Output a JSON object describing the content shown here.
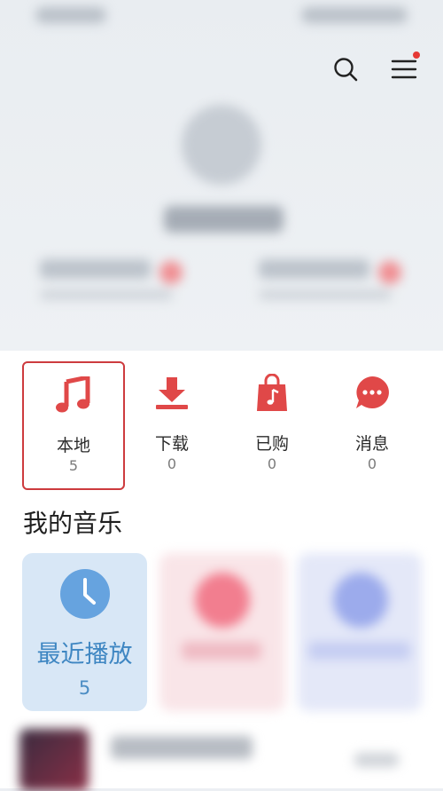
{
  "quick_access": [
    {
      "label": "本地",
      "count": "5",
      "icon": "music-note-icon",
      "selected": true
    },
    {
      "label": "下载",
      "count": "0",
      "icon": "download-icon",
      "selected": false
    },
    {
      "label": "已购",
      "count": "0",
      "icon": "shopping-bag-icon",
      "selected": false
    },
    {
      "label": "消息",
      "count": "0",
      "icon": "message-icon",
      "selected": false
    }
  ],
  "section": {
    "title": "我的音乐"
  },
  "recent_card": {
    "label": "最近播放",
    "count": "5",
    "icon": "clock-icon"
  },
  "colors": {
    "accent_red": "#e04848",
    "selected_border": "#cd3b3e",
    "recent_blue": "#3e86c2",
    "recent_bg": "#d8e7f6"
  }
}
